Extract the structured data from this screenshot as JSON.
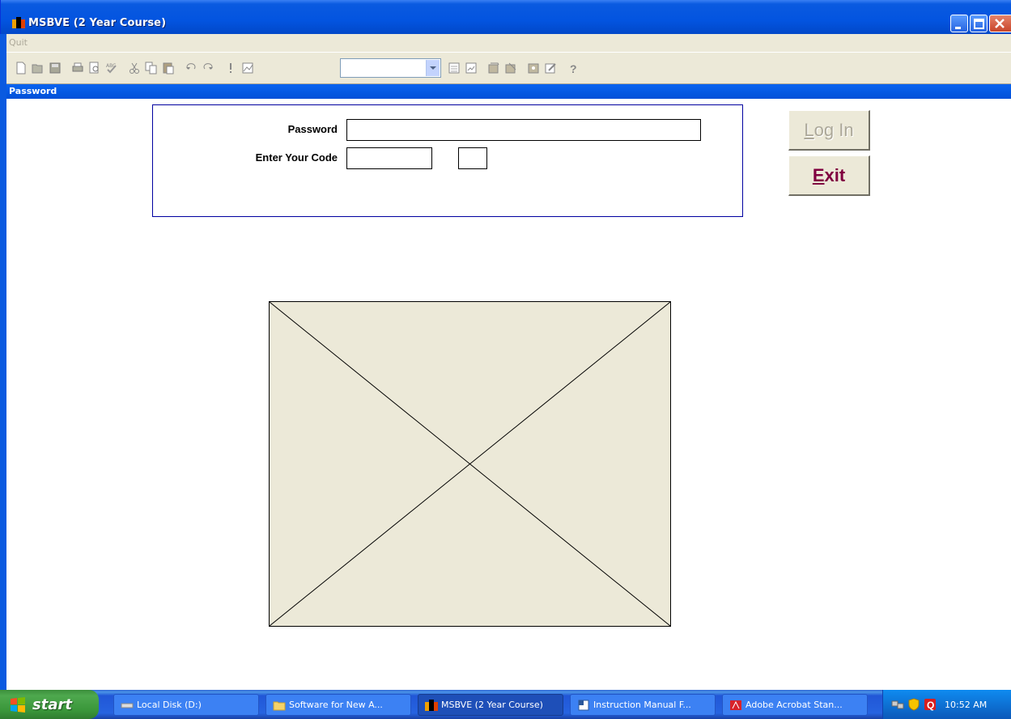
{
  "window": {
    "title": "MSBVE (2 Year Course)"
  },
  "menu": {
    "quit": "Quit"
  },
  "form": {
    "caption": "Password",
    "password_label": "Password",
    "code_label": "Enter Your Code",
    "password_value": "",
    "code_value": "",
    "code2_value": ""
  },
  "buttons": {
    "login_first": "L",
    "login_rest": "og In",
    "exit_first": "E",
    "exit_rest": "xit"
  },
  "taskbar": {
    "start": "start",
    "tasks": [
      {
        "label": "Local Disk (D:)",
        "icon": "drive-icon"
      },
      {
        "label": "Software for New A...",
        "icon": "folder-icon"
      },
      {
        "label": "MSBVE (2 Year Course)",
        "icon": "app-icon",
        "active": true
      },
      {
        "label": "Instruction Manual F...",
        "icon": "word-doc-icon"
      },
      {
        "label": "Adobe Acrobat Stan...",
        "icon": "acrobat-icon"
      }
    ],
    "clock": "10:52 AM"
  },
  "colors": {
    "titlebar": "#0354e0",
    "exit_text": "#800040",
    "panel_border": "#0000a0"
  }
}
